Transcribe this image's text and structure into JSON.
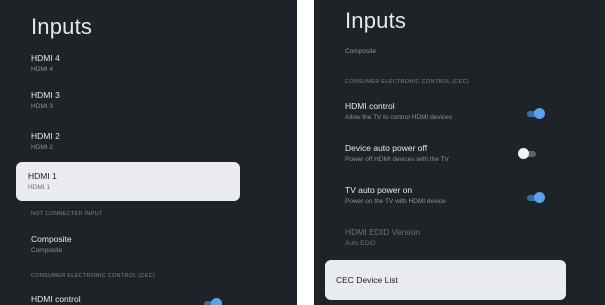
{
  "left": {
    "title": "Inputs",
    "items": [
      {
        "label": "HDMI 4",
        "sub": "HDMI 4"
      },
      {
        "label": "HDMI 3",
        "sub": "HDMI 3"
      },
      {
        "label": "HDMI 2",
        "sub": "HDMI 2"
      },
      {
        "label": "HDMI 1",
        "sub": "HDMI 1"
      }
    ],
    "section_not_connected": "NOT CONNECTED INPUT",
    "composite": {
      "label": "Composite",
      "sub": "Composite"
    },
    "section_cec": "CONSUMER ELECTRONIC CONTROL (CEC)",
    "hdmi_control": {
      "label": "HDMI control",
      "on": true
    }
  },
  "right": {
    "title": "Inputs",
    "composite_sub": "Composite",
    "section_cec": "CONSUMER ELECTRONIC CONTROL (CEC)",
    "toggles": [
      {
        "label": "HDMI control",
        "sub": "Allow the TV to control HDMI devices",
        "on": true
      },
      {
        "label": "Device auto power off",
        "sub": "Power off HDMI devices with the TV",
        "on": false
      },
      {
        "label": "TV auto power on",
        "sub": "Power on the TV with HDMI device",
        "on": true
      }
    ],
    "edid": {
      "label": "HDMI EDID Version",
      "sub": "Auto EDID"
    },
    "cec_device_list": "CEC Device List"
  },
  "colors": {
    "panel_bg": "#1e2327",
    "toggle_on": "#5aa2f0",
    "selected_bg": "#e9ebee"
  }
}
